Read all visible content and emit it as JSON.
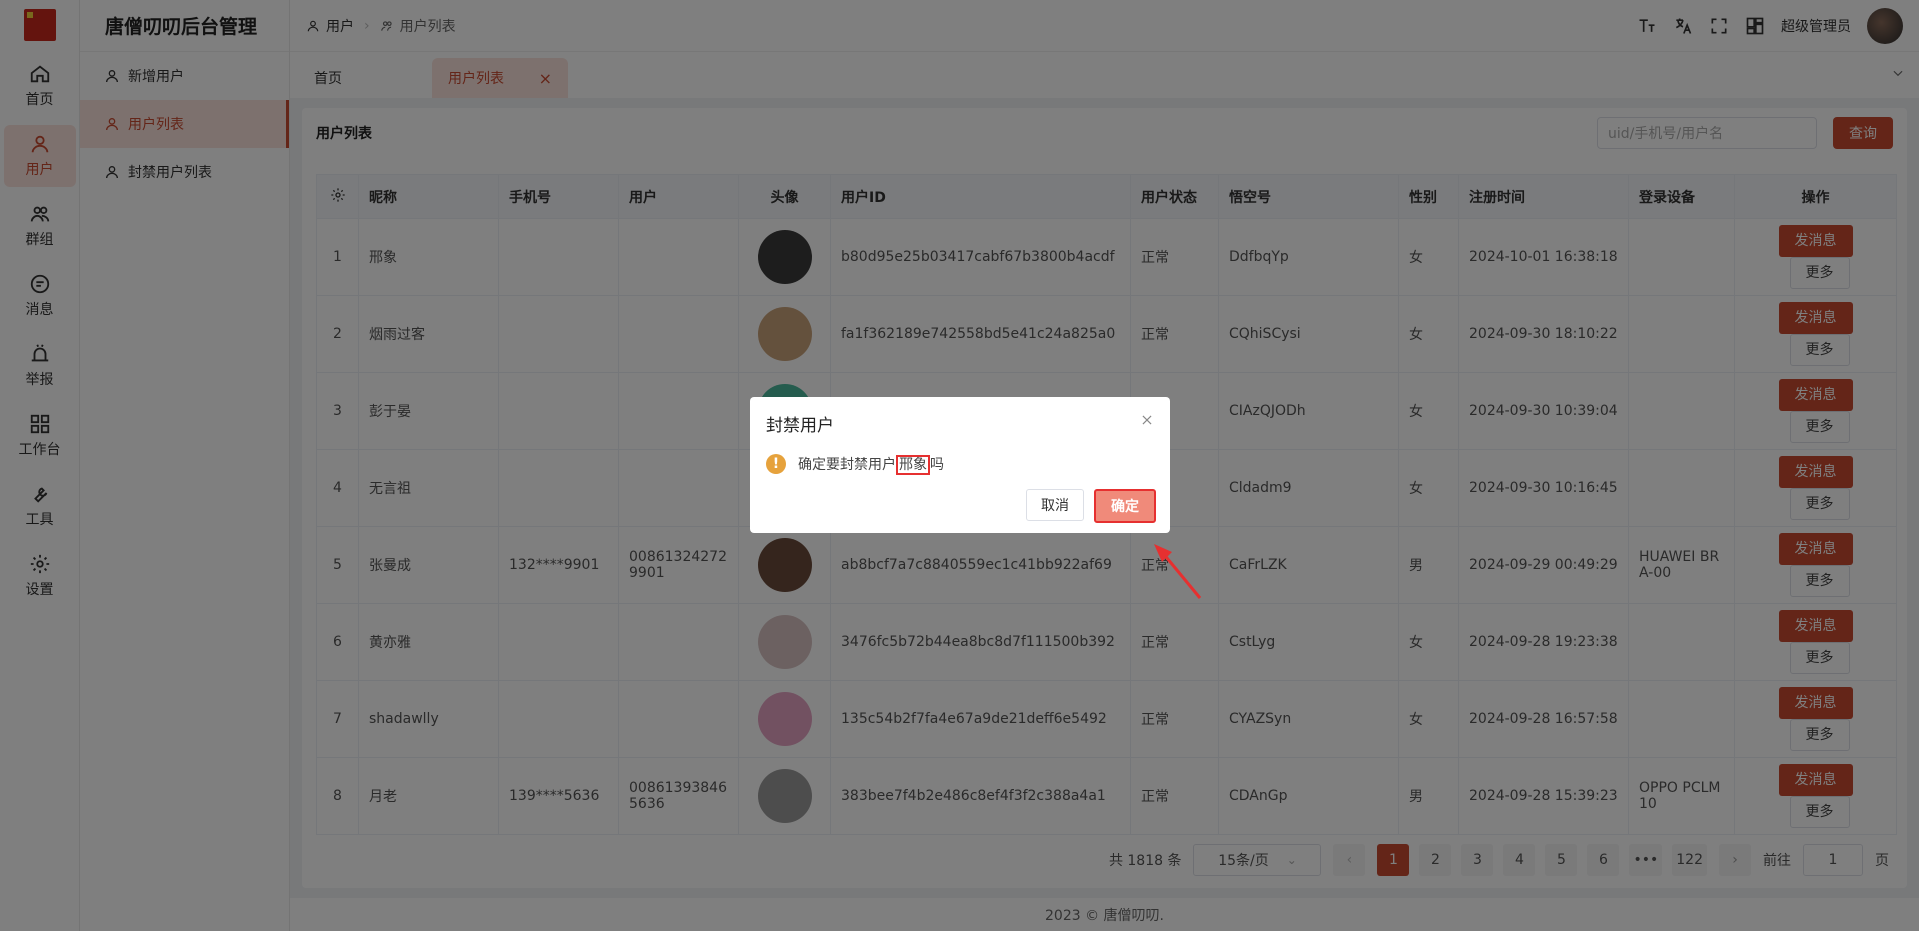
{
  "app_title": "唐僧叨叨后台管理",
  "rail": [
    {
      "label": "首页",
      "icon": "home-icon"
    },
    {
      "label": "用户",
      "icon": "user-icon",
      "active": true
    },
    {
      "label": "群组",
      "icon": "group-icon"
    },
    {
      "label": "消息",
      "icon": "message-icon"
    },
    {
      "label": "举报",
      "icon": "alarm-icon"
    },
    {
      "label": "工作台",
      "icon": "grid-icon"
    },
    {
      "label": "工具",
      "icon": "wrench-icon"
    },
    {
      "label": "设置",
      "icon": "gear-icon"
    }
  ],
  "submenu": [
    {
      "label": "新增用户"
    },
    {
      "label": "用户列表",
      "active": true
    },
    {
      "label": "封禁用户列表"
    }
  ],
  "breadcrumb": {
    "root": "用户",
    "current": "用户列表"
  },
  "header": {
    "role": "超级管理员"
  },
  "tabs": {
    "home": "首页",
    "active": "用户列表"
  },
  "card": {
    "title": "用户列表",
    "search_placeholder": "uid/手机号/用户名",
    "search_button": "查询"
  },
  "table": {
    "headers": [
      "昵称",
      "手机号",
      "用户",
      "头像",
      "用户ID",
      "用户状态",
      "悟空号",
      "性别",
      "注册时间",
      "登录设备",
      "操作"
    ],
    "send_label": "发消息",
    "more_label": "更多",
    "rows": [
      {
        "no": "1",
        "nick": "邢象",
        "phone": "",
        "user": "",
        "uid": "b80d95e25b03417cabf67b3800b4acdf",
        "status": "正常",
        "wk": "DdfbqYp",
        "sex": "女",
        "time": "2024-10-01 16:38:18",
        "device": "",
        "avatar": "#3a3a3a"
      },
      {
        "no": "2",
        "nick": "烟雨过客",
        "phone": "",
        "user": "",
        "uid": "fa1f362189e742558bd5e41c24a825a0",
        "status": "正常",
        "wk": "CQhiSCysi",
        "sex": "女",
        "time": "2024-09-30 18:10:22",
        "device": "",
        "avatar": "#c9a27a"
      },
      {
        "no": "3",
        "nick": "彭于晏",
        "phone": "",
        "user": "",
        "uid": "",
        "status": "",
        "wk": "CIAzQJODh",
        "sex": "女",
        "time": "2024-09-30 10:39:04",
        "device": "",
        "avatar": "#4bb89c"
      },
      {
        "no": "4",
        "nick": "无言祖",
        "phone": "",
        "user": "",
        "uid": "",
        "status": "",
        "wk": "Cldadm9",
        "sex": "女",
        "time": "2024-09-30 10:16:45",
        "device": "",
        "avatar": "#888888"
      },
      {
        "no": "5",
        "nick": "张曼成",
        "phone": "132****9901",
        "user": "008613242729901",
        "uid": "ab8bcf7a7c8840559ec1c41bb922af69",
        "status": "正常",
        "wk": "CaFrLZK",
        "sex": "男",
        "time": "2024-09-29 00:49:29",
        "device": "HUAWEI BRA-00",
        "avatar": "#6b4a3a"
      },
      {
        "no": "6",
        "nick": "黄亦雅",
        "phone": "",
        "user": "",
        "uid": "3476fc5b72b44ea8bc8d7f111500b392",
        "status": "正常",
        "wk": "CstLyg",
        "sex": "女",
        "time": "2024-09-28 19:23:38",
        "device": "",
        "avatar": "#d9c3c3"
      },
      {
        "no": "7",
        "nick": "shadawlly",
        "phone": "",
        "user": "",
        "uid": "135c54b2f7fa4e67a9de21deff6e5492",
        "status": "正常",
        "wk": "CYAZSyn",
        "sex": "女",
        "time": "2024-09-28 16:57:58",
        "device": "",
        "avatar": "#e5a3c3"
      },
      {
        "no": "8",
        "nick": "月老",
        "phone": "139****5636",
        "user": "008613938465636",
        "uid": "383bee7f4b2e486c8ef4f3f2c388a4a1",
        "status": "正常",
        "wk": "CDAnGp",
        "sex": "男",
        "time": "2024-09-28 15:39:23",
        "device": "OPPO PCLM10",
        "avatar": "#9a9a9a"
      }
    ]
  },
  "pager": {
    "total": "共 1818 条",
    "size": "15条/页",
    "pages": [
      "1",
      "2",
      "3",
      "4",
      "5",
      "6",
      "•••",
      "122"
    ],
    "goto": "前往",
    "goto_value": "1",
    "page_unit": "页"
  },
  "footer": "2023 © 唐僧叨叨.",
  "dialog": {
    "title": "封禁用户",
    "msg_prefix": "确定要封禁用户",
    "msg_name": "邢象",
    "msg_suffix": "吗",
    "cancel": "取消",
    "ok": "确定"
  }
}
